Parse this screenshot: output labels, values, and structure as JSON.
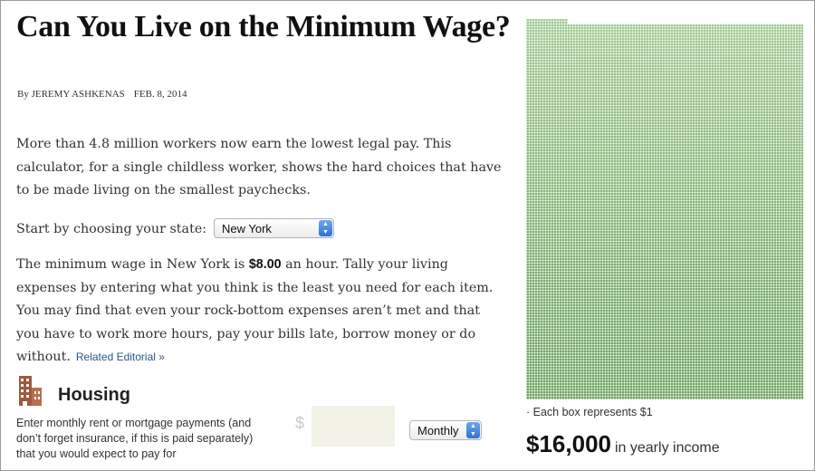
{
  "article": {
    "headline": "Can You Live on the Minimum Wage?",
    "author": "By JEREMY ASHKENAS",
    "date": "FEB. 8, 2014",
    "intro": "More than 4.8 million workers now earn the lowest legal pay. This calculator, for a single childless worker, shows the hard choices that have to be made living on the smallest paychecks.",
    "state_prompt": "Start by choosing your state:",
    "min_wage_before": "The minimum wage in New York is ",
    "min_wage_value": "$8.00",
    "min_wage_after": " an hour. Tally your living expenses by entering what you think is the least you need for each item. You may find that even your rock-bottom expenses aren’t met and that you have to work more hours, pay your bills late, borrow money or do without.",
    "related_link": "Related Editorial »"
  },
  "state_select": {
    "value": "New York"
  },
  "housing": {
    "icon": "building-icon",
    "title": "Housing",
    "description": "Enter monthly rent or mortgage payments (and don’t forget insurance, if this is paid separately) that you would expect to pay for",
    "currency_symbol": "$",
    "amount_value": "",
    "frequency": "Monthly"
  },
  "sidebar": {
    "grid_note": "· Each box represents $1",
    "income_amount": "$16,000",
    "income_label": "in yearly income"
  },
  "colors": {
    "box_green": "#7eb06f",
    "link_blue": "#2b5689",
    "input_bg": "#f2f2e7",
    "icon_brown": "#9e5a3e"
  }
}
